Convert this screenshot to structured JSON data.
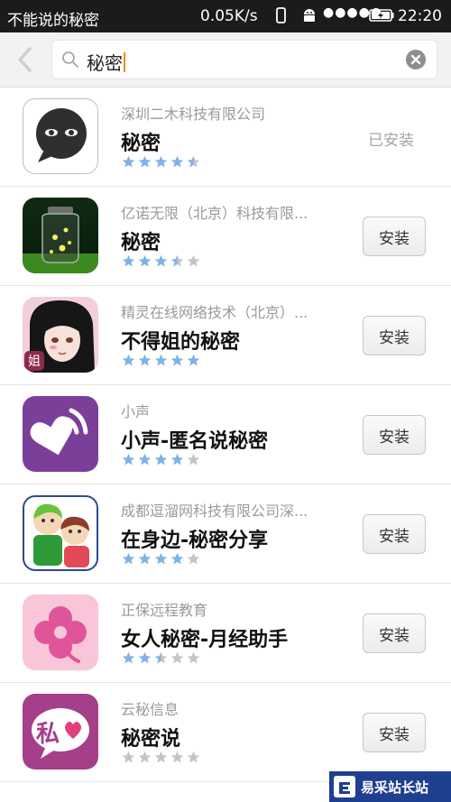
{
  "status_bar": {
    "title": "不能说的秘密",
    "speed": "0.05K/s",
    "signal": "●●●●●",
    "time": "22:20"
  },
  "search": {
    "query": "秘密"
  },
  "apps": [
    {
      "company": "深圳二木科技有限公司",
      "name": "秘密",
      "rating": 4.5,
      "action": "已安装",
      "installed": true
    },
    {
      "company": "亿诺无限（北京）科技有限...",
      "name": "秘密",
      "rating": 3.5,
      "action": "安装",
      "installed": false
    },
    {
      "company": "精灵在线网络技术（北京）...",
      "name": "不得姐的秘密",
      "rating": 5,
      "action": "安装",
      "installed": false
    },
    {
      "company": "小声",
      "name": "小声-匿名说秘密",
      "rating": 4,
      "action": "安装",
      "installed": false
    },
    {
      "company": "成都逗溜网科技有限公司深...",
      "name": "在身边-秘密分享",
      "rating": 4,
      "action": "安装",
      "installed": false
    },
    {
      "company": "正保远程教育",
      "name": "女人秘密-月经助手",
      "rating": 2.5,
      "action": "安装",
      "installed": false
    },
    {
      "company": "云秘信息",
      "name": "秘密说",
      "rating": 0,
      "action": "安装",
      "installed": false
    }
  ],
  "app_icons": {
    "icon_text_pink": "姐",
    "icon_text_simi": "私"
  },
  "watermark": {
    "title": "易采站长站"
  },
  "colors": {
    "star_on": "#7fb2e6",
    "star_off": "#c4c4c4",
    "status_bg": "#1b1b1b"
  }
}
